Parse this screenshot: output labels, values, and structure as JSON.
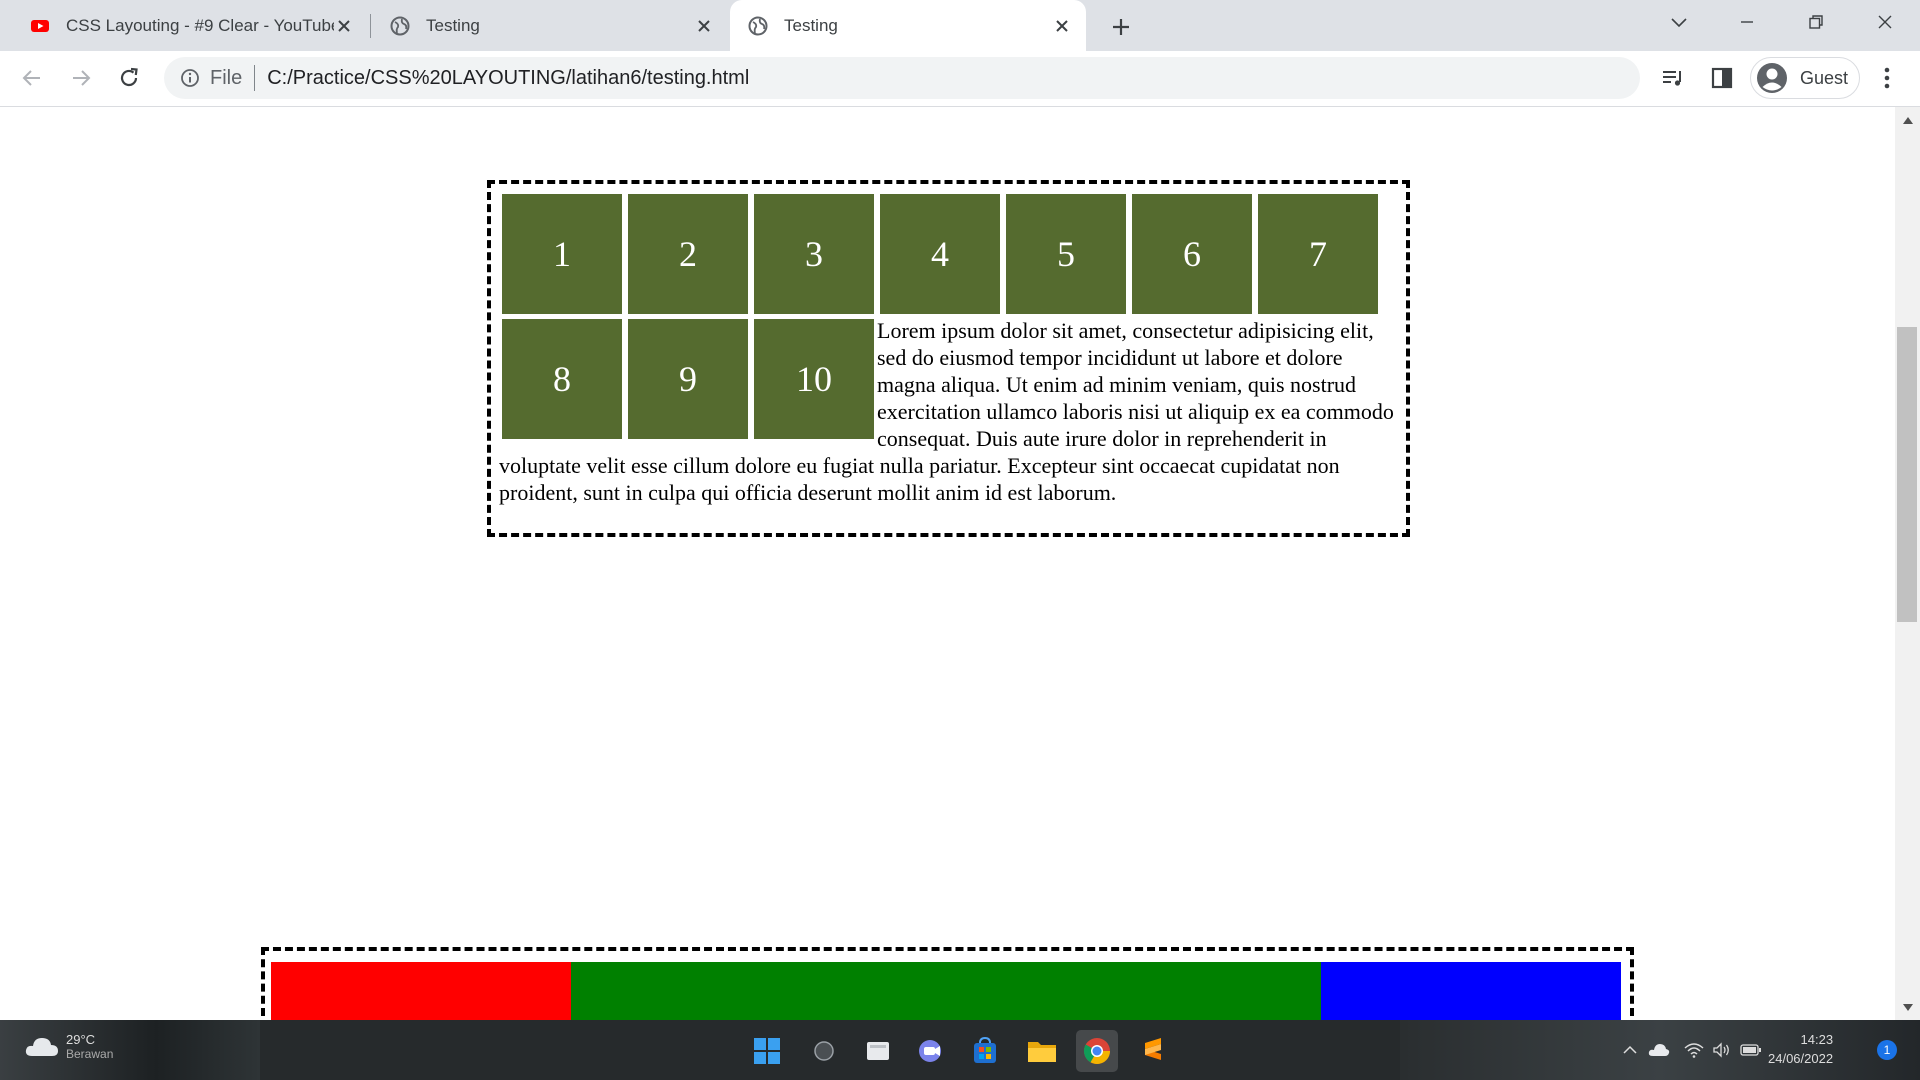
{
  "browser": {
    "tabs": [
      {
        "title": "CSS Layouting - #9 Clear - YouTube",
        "icon": "youtube-icon",
        "active": false
      },
      {
        "title": "Testing",
        "icon": "globe-icon",
        "active": false
      },
      {
        "title": "Testing",
        "icon": "globe-icon",
        "active": true
      }
    ],
    "address": {
      "scheme_label": "File",
      "url": "C:/Practice/CSS%20LAYOUTING/latihan6/testing.html"
    },
    "profile_name": "Guest"
  },
  "page": {
    "boxes": [
      "1",
      "2",
      "3",
      "4",
      "5",
      "6",
      "7",
      "8",
      "9",
      "10"
    ],
    "box_color": "#556b2f",
    "lorem": "Lorem ipsum dolor sit amet, consectetur adipisicing elit, sed do eiusmod tempor incididunt ut labore et dolore magna aliqua. Ut enim ad minim veniam, quis nostrud exercitation ullamco laboris nisi ut aliquip ex ea commodo consequat. Duis aute irure dolor in reprehenderit in voluptate velit esse cillum dolore eu fugiat nulla pariatur. Excepteur sint occaecat cupidatat non proident, sunt in culpa qui officia deserunt mollit anim id est laborum.",
    "columns": [
      {
        "color": "#ff0000"
      },
      {
        "color": "#008000"
      },
      {
        "color": "#0000ff"
      }
    ]
  },
  "taskbar": {
    "weather_temp": "29°C",
    "weather_desc": "Berawan",
    "time": "14:23",
    "date": "24/06/2022",
    "notifications": "1",
    "apps": [
      "windows-start-icon",
      "search-icon",
      "task-view-icon",
      "teams-icon",
      "store-icon",
      "file-explorer-icon",
      "chrome-icon",
      "sublime-text-icon"
    ]
  }
}
